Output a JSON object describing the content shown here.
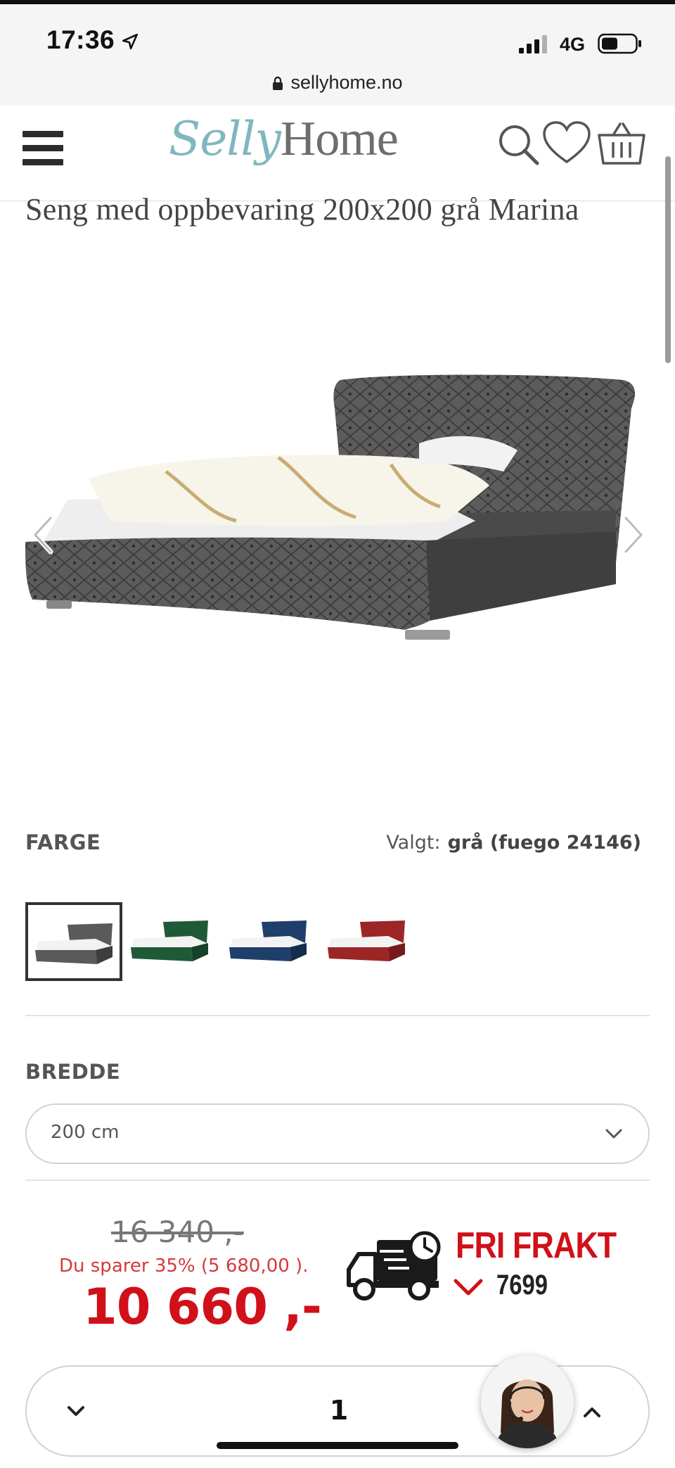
{
  "status_bar": {
    "time": "17:36",
    "network": "4G",
    "url": "sellyhome.no"
  },
  "header": {
    "logo_part1": "Selly",
    "logo_part2": "Home"
  },
  "product": {
    "title": "Seng med oppbevaring 200x200 grå Marina"
  },
  "colour": {
    "label": "FARGE",
    "selected_label": "Valgt:",
    "selected_value": "grå (fuego 24146)",
    "swatches": [
      {
        "name": "grå",
        "color": "#5a5a5a",
        "active": true
      },
      {
        "name": "grønn",
        "color": "#1f5a36",
        "active": false
      },
      {
        "name": "blå",
        "color": "#1f3f6b",
        "active": false
      },
      {
        "name": "rød",
        "color": "#9c2626",
        "active": false
      }
    ]
  },
  "width": {
    "label": "BREDDE",
    "selected": "200 cm"
  },
  "price": {
    "old": "16 340 ,-",
    "savings": "Du sparer 35% (5 680,00 ).",
    "new": "10 660 ,-"
  },
  "shipping": {
    "headline": "FRI FRAKT",
    "code": "7699"
  },
  "quantity": {
    "value": "1"
  },
  "colors": {
    "accent_red": "#d0111a",
    "logo_teal": "#7fb7c0"
  }
}
